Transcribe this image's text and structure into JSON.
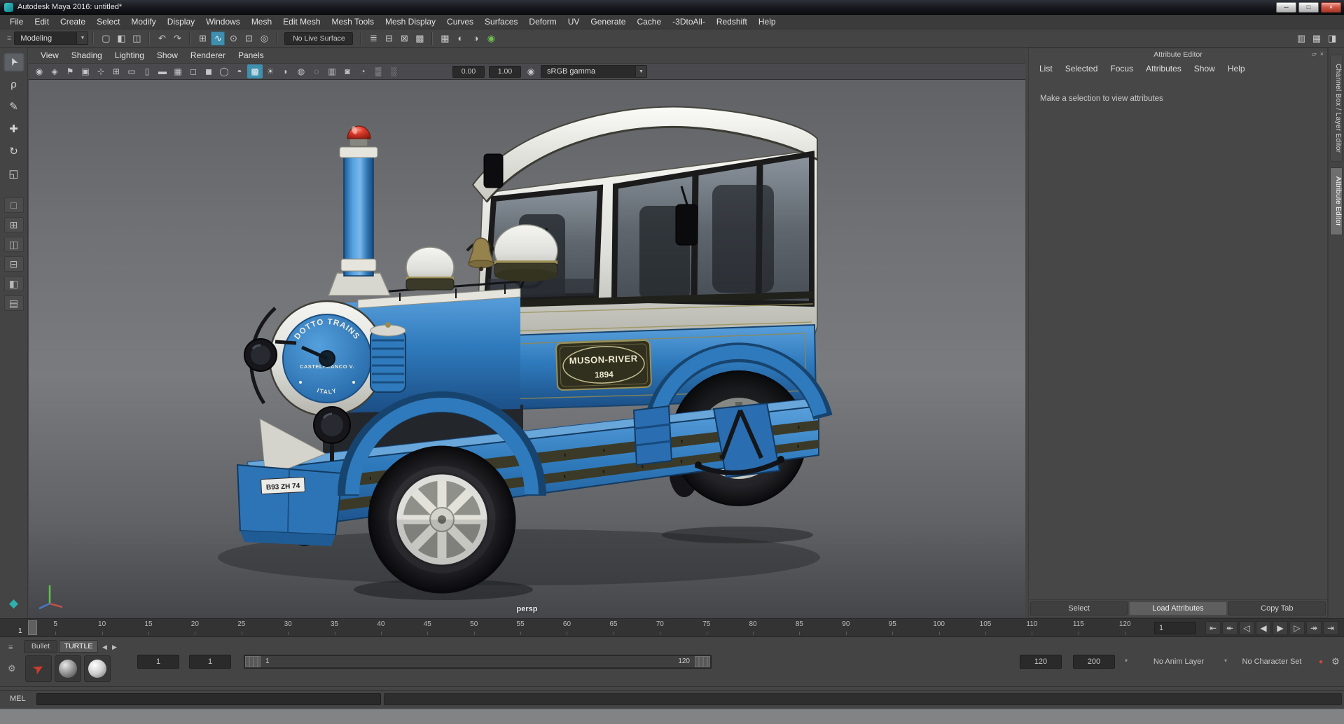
{
  "window": {
    "title": "Autodesk Maya 2016: untitled*"
  },
  "icons": {
    "dropdown": "▼",
    "grab": "≡"
  },
  "titlebar_icons": {
    "minimize": "─",
    "maximize": "□",
    "close": "×"
  },
  "menubar": {
    "items": [
      "File",
      "Edit",
      "Create",
      "Select",
      "Modify",
      "Display",
      "Windows",
      "Mesh",
      "Edit Mesh",
      "Mesh Tools",
      "Mesh Display",
      "Curves",
      "Surfaces",
      "Deform",
      "UV",
      "Generate",
      "Cache",
      "-3DtoAll-",
      "Redshift",
      "Help"
    ]
  },
  "status_line": {
    "mode": "Modeling",
    "no_live_surface": "No Live Surface",
    "file_icons": [
      {
        "n": "new-scene-icon",
        "g": "▢"
      },
      {
        "n": "open-scene-icon",
        "g": "◧"
      },
      {
        "n": "save-scene-icon",
        "g": "◫"
      }
    ],
    "undo_icons": [
      {
        "n": "undo-icon",
        "g": "↶"
      },
      {
        "n": "redo-icon",
        "g": "↷"
      }
    ],
    "snap_icons": [
      {
        "n": "snap-grid-icon",
        "g": "⊞"
      },
      {
        "n": "snap-curve-icon",
        "g": "∿",
        "a": 1
      },
      {
        "n": "snap-point-icon",
        "g": "⊙"
      },
      {
        "n": "snap-plane-icon",
        "g": "⊡"
      },
      {
        "n": "make-live-icon",
        "g": "◎"
      }
    ],
    "history_icons": [
      {
        "n": "construction-history-icon",
        "g": "≣"
      },
      {
        "n": "inputs-icon",
        "g": "⊟"
      },
      {
        "n": "outputs-icon",
        "g": "⊠"
      },
      {
        "n": "history-toggle-icon",
        "g": "▩"
      }
    ],
    "render_icons": [
      {
        "n": "render-view-icon",
        "g": "▦"
      },
      {
        "n": "ipr-render-icon",
        "g": "◐"
      },
      {
        "n": "render-settings-icon",
        "g": "◑"
      }
    ],
    "render_globe": "◉",
    "panel_toggles": [
      {
        "n": "sidebar-attribute-editor-toggle-icon",
        "g": "▥"
      },
      {
        "n": "sidebar-tool-settings-toggle-icon",
        "g": "▦"
      },
      {
        "n": "sidebar-channel-box-toggle-icon",
        "g": "◨"
      }
    ]
  },
  "panel_menu": {
    "items": [
      "View",
      "Shading",
      "Lighting",
      "Show",
      "Renderer",
      "Panels"
    ]
  },
  "viewport_bar": {
    "icons": [
      {
        "n": "camera-select-icon",
        "g": "◉"
      },
      {
        "n": "camera-lock-icon",
        "g": "◈"
      },
      {
        "n": "camera-bookmark-icon",
        "g": "⚑"
      },
      {
        "n": "image-plane-icon",
        "g": "▣"
      },
      {
        "n": "pan-zoom-icon",
        "g": "⊹"
      },
      {
        "n": "grid-toggle-icon",
        "g": "⊞"
      },
      {
        "n": "film-gate-icon",
        "g": "▭"
      },
      {
        "n": "resolution-gate-icon",
        "g": "▯"
      },
      {
        "n": "gate-mask-icon",
        "g": "▬"
      },
      {
        "n": "field-chart-icon",
        "g": "▦"
      },
      {
        "n": "safe-action-icon",
        "g": "◻"
      },
      {
        "n": "safe-title-icon",
        "g": "◼"
      },
      {
        "n": "wireframe-icon",
        "g": "◯"
      },
      {
        "n": "shaded-mode-icon",
        "g": "◓"
      },
      {
        "n": "textured-mode-icon",
        "g": "▩",
        "a": 1
      },
      {
        "n": "all-lights-icon",
        "g": "☀"
      },
      {
        "n": "shadows-icon",
        "g": "◗"
      },
      {
        "n": "ao-icon",
        "g": "◍"
      },
      {
        "n": "motion-blur-icon",
        "g": "◌"
      },
      {
        "n": "multisample-icon",
        "g": "▥"
      },
      {
        "n": "dof-icon",
        "g": "◙"
      },
      {
        "n": "isolate-select-icon",
        "g": "◔"
      },
      {
        "n": "xray-icon",
        "g": "▒"
      },
      {
        "n": "joint-xray-icon",
        "g": "░"
      }
    ],
    "exposure": "0.00",
    "contrast": "1.00",
    "gamma_icon": "◉",
    "gamma": "sRGB gamma"
  },
  "toolbox": {
    "tools": [
      {
        "n": "select-tool-icon",
        "g": "➤",
        "a": 1
      },
      {
        "n": "lasso-tool-icon",
        "g": "ρ"
      },
      {
        "n": "paint-select-tool-icon",
        "g": "✎"
      },
      {
        "n": "move-tool-icon",
        "g": "✚"
      },
      {
        "n": "rotate-tool-icon",
        "g": "↻"
      },
      {
        "n": "scale-tool-icon",
        "g": "◱"
      }
    ],
    "layouts": [
      {
        "n": "layout-single-icon",
        "g": "□"
      },
      {
        "n": "layout-four-pane-icon",
        "g": "⊞"
      },
      {
        "n": "layout-two-side-icon",
        "g": "◫"
      },
      {
        "n": "layout-two-stacked-icon",
        "g": "⊟"
      },
      {
        "n": "layout-outliner-icon",
        "g": "◧"
      },
      {
        "n": "layout-custom-icon",
        "g": "▤"
      }
    ],
    "logo": "◆"
  },
  "viewport": {
    "camera": "persp"
  },
  "train": {
    "brand_arc": "DOTTO TRAINS",
    "brand_mid": "CASTELFRANCO V.",
    "brand_bottom": "ITALY",
    "plaque_title": "MUSON-RIVER",
    "plaque_year": "1894",
    "license_plate": "B93 ZH 74"
  },
  "attribute_editor": {
    "title": "Attribute Editor",
    "menu": [
      "List",
      "Selected",
      "Focus",
      "Attributes",
      "Show",
      "Help"
    ],
    "message": "Make a selection to view attributes",
    "select": "Select",
    "load": "Load Attributes",
    "copy": "Copy Tab",
    "float_icon": "▱",
    "close_icon": "×"
  },
  "side_tabs": {
    "channel_box": "Channel Box / Layer Editor",
    "attribute_editor": "Attribute Editor"
  },
  "timeline": {
    "ticks": [
      5,
      10,
      15,
      20,
      25,
      30,
      35,
      40,
      45,
      50,
      55,
      60,
      65,
      70,
      75,
      80,
      85,
      90,
      95,
      100,
      105,
      110,
      115,
      120
    ],
    "playhead": "1",
    "current_frame": "1",
    "playback": [
      {
        "n": "go-to-start-button",
        "g": "⇤"
      },
      {
        "n": "step-back-key-button",
        "g": "↞"
      },
      {
        "n": "play-backwards-button",
        "g": "◁"
      },
      {
        "n": "step-back-frame-button",
        "g": "◀"
      },
      {
        "n": "step-forward-frame-button",
        "g": "▶"
      },
      {
        "n": "play-forward-button",
        "g": "▷"
      },
      {
        "n": "step-forward-key-button",
        "g": "↠"
      },
      {
        "n": "go-to-end-button",
        "g": "⇥"
      }
    ]
  },
  "range_slider": {
    "anim_start": "1",
    "playback_start": "1",
    "range_start": "1",
    "range_end": "120",
    "playback_end": "120",
    "anim_end": "200",
    "anim_layer": "No Anim Layer",
    "character_set": "No Character Set",
    "autokey_icon": "●",
    "prefs_icon": "⚙",
    "dropdown": "▾"
  },
  "shelf": {
    "hamburger": "≡",
    "gear": "⚙",
    "tabs": [
      {
        "n": "shelf-tab-bullet",
        "t": "Bullet"
      },
      {
        "n": "shelf-tab-turtle",
        "t": "TURTLE",
        "a": 1
      }
    ],
    "prev": "◀",
    "next": "▶",
    "bullet_glyph": "➤"
  },
  "command_line": {
    "label": "MEL"
  }
}
